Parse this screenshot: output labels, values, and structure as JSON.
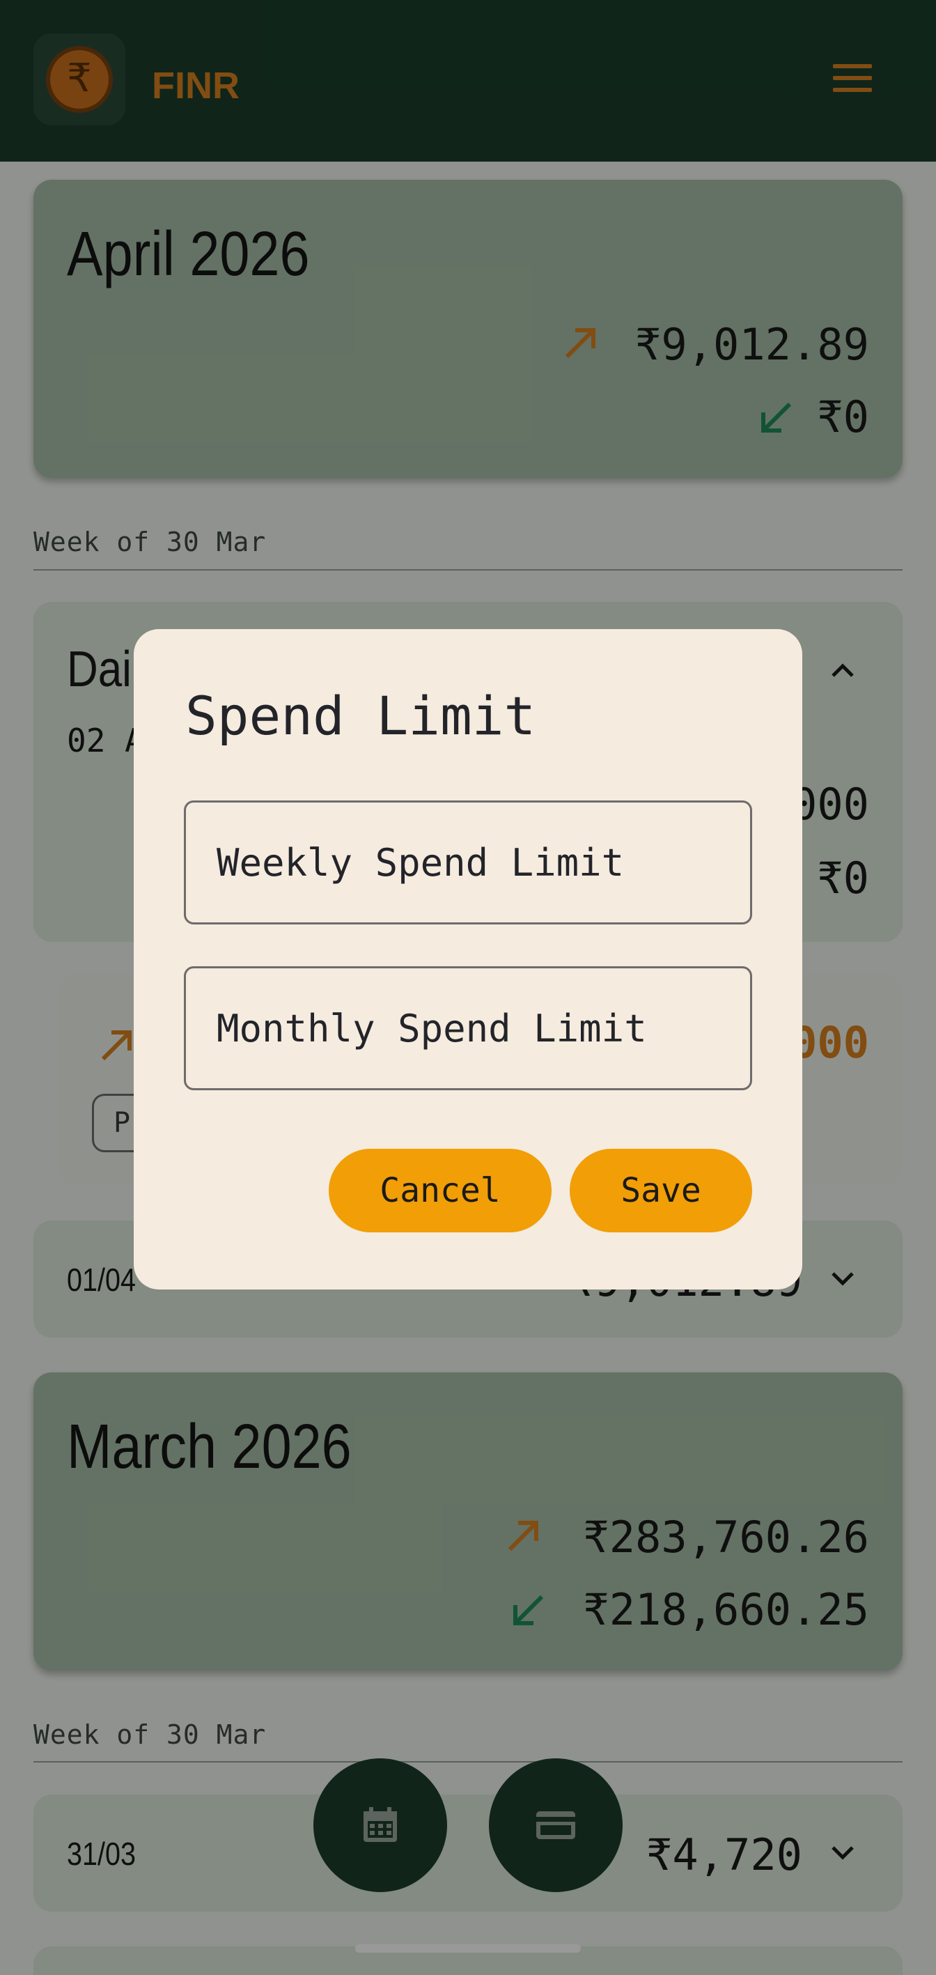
{
  "app": {
    "title": "FINR",
    "logo_symbol": "₹"
  },
  "months": [
    {
      "title": "April 2026",
      "spent": "₹9,012.89",
      "received": "₹0",
      "week_label": "Week of 30 Mar",
      "day_card": {
        "title": "Dai",
        "date": "02 A",
        "amount1": "000",
        "amount2": "₹0"
      },
      "txn": {
        "amount": "000",
        "chip": "P"
      },
      "row": {
        "date": "01/04",
        "amount": "₹9,012.89"
      }
    },
    {
      "title": "March 2026",
      "spent": "₹283,760.26",
      "received": "₹218,660.25",
      "week_label": "Week of 30 Mar",
      "row": {
        "date": "31/03",
        "amount": "₹4,720"
      }
    }
  ],
  "fab": {
    "calendar_icon": "calendar-icon",
    "card_icon": "credit-card-icon"
  },
  "dialog": {
    "title": "Spend Limit",
    "weekly_placeholder": "Weekly Spend Limit",
    "monthly_placeholder": "Monthly Spend Limit",
    "cancel_label": "Cancel",
    "save_label": "Save"
  },
  "colors": {
    "app_bar": "#1b3d2c",
    "accent_orange": "#d8801e",
    "income_green": "#1f8a5a",
    "button": "#f19e07",
    "dialog_bg": "#f5ebde"
  }
}
